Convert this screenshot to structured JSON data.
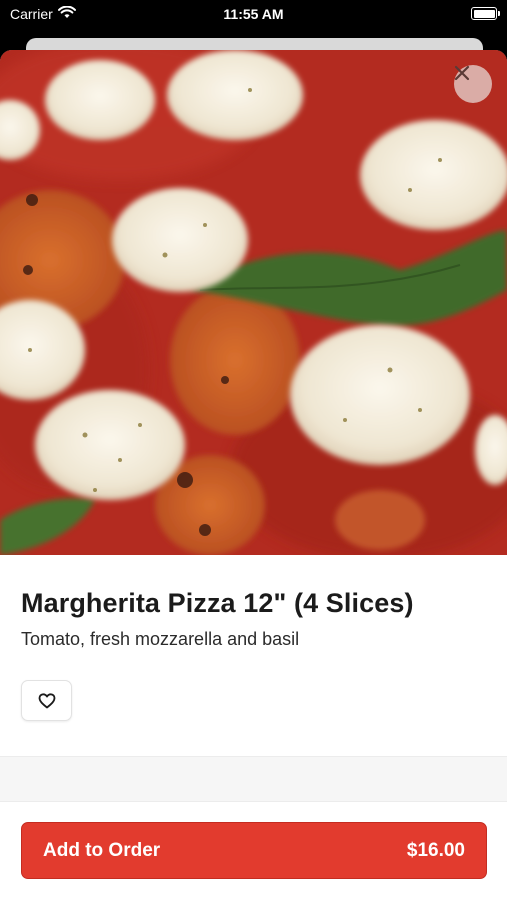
{
  "status_bar": {
    "carrier": "Carrier",
    "time": "11:55 AM"
  },
  "item": {
    "title": "Margherita Pizza 12\" (4 Slices)",
    "description": "Tomato, fresh mozzarella and basil",
    "hero_image": "pizza-photo"
  },
  "actions": {
    "close_icon": "close-icon",
    "favorite_icon": "heart-icon",
    "add_label": "Add to Order",
    "price": "$16.00"
  },
  "colors": {
    "accent": "#e23b2e",
    "sauce": "#b22d22",
    "mozzarella": "#f4efe3",
    "basil": "#3f6a2c"
  }
}
